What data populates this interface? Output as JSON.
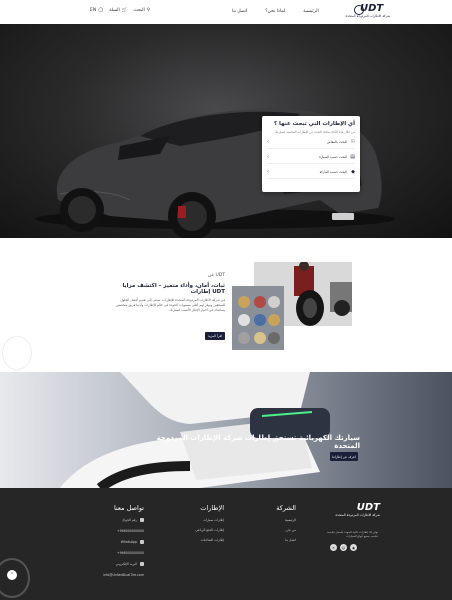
{
  "header": {
    "lang": "EN",
    "cart_label": "السلة",
    "search_label": "البحث",
    "nav": [
      "الرئيسية",
      "لماذا نحن؟",
      "اتصل بنا"
    ],
    "logo_mark": "UDT",
    "logo_text": "شركة الاطارات المزدوجة المتحدة"
  },
  "hero": {
    "finder_title": "أي الإطارات التي تبحث عنها ؟",
    "finder_desc": "من خلال هذه الأداة يمكنك البحث عن الإطارات المناسبة لسيارتك",
    "rows": [
      {
        "text": "البحث بالمقاس",
        "icon": "tire-icon"
      },
      {
        "text": "البحث حسب السيارة",
        "icon": "car-icon"
      },
      {
        "text": "البحث حسب الماركة",
        "icon": "tag-icon"
      }
    ]
  },
  "about": {
    "label": "عن UDT",
    "title": "ثبات، أمان، وأداء متميز – اكتشف مزايا إطارات UDT",
    "body": "في شركة الاطارات المزدوجة المتحدة للإطارات، نسعى إلى تقديم أفضل الحلول للسائقين ونوفر لهم أعلى مستويات الجودة في عالم الإطارات ولدينا فريق متخصص يساعدك في اختيار الإطار الأنسب لسيارتك",
    "button": "اقرأ المزيد"
  },
  "ev": {
    "title": "سيارتك الكهربائية تستحق إطارات شركة الإطارات المزدوجة المتحدة",
    "button": "اعرف عن إطاراتنا"
  },
  "footer": {
    "logo_mark": "UDT",
    "logo_text": "شركة الاطارات المزدوجة المتحدة",
    "desc": "نوفر لك إطارات عالية الجودة بأسعار مناسبة تناسب جميع أنواع السيارات",
    "company_title": "الشركة",
    "company_items": [
      "الرئيسية",
      "من نحن",
      "اتصل بنا"
    ],
    "tires_title": "الإطارات",
    "tires_items": [
      "إطارات سيارات",
      "إطارات الدفع الرباعي",
      "إطارات الشاحنات"
    ],
    "contact_title": "تواصل معنا",
    "contact_items": [
      "رقم الجوال",
      "+966000000000",
      "WhatsApp",
      "+966000000000",
      "البريد الإلكتروني",
      "info@UnitedDualTire.com"
    ]
  }
}
